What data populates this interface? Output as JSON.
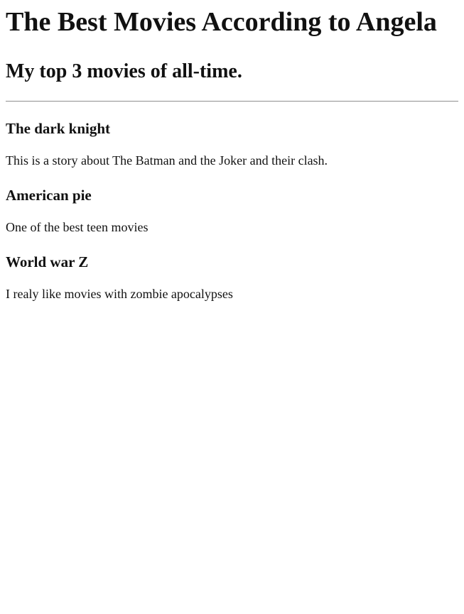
{
  "page": {
    "title": "The Best Movies According to Angela",
    "subtitle": "My top 3 movies of all-time."
  },
  "movies": [
    {
      "title": "The dark knight",
      "description": "This is a story about The Batman and the Joker and their clash."
    },
    {
      "title": "American pie",
      "description": "One of the best teen movies"
    },
    {
      "title": "World war Z",
      "description": "I realy like movies with zombie apocalypses"
    }
  ]
}
